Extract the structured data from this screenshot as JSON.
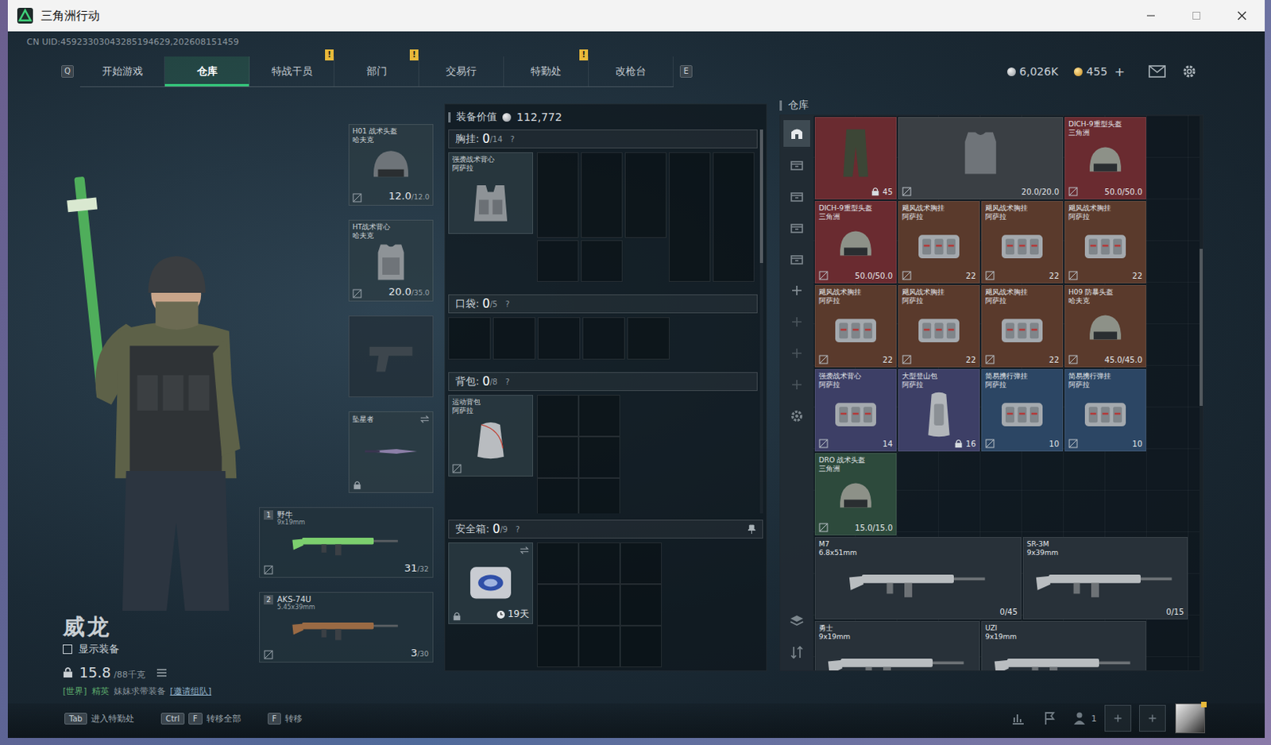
{
  "window": {
    "title": "三角洲行动"
  },
  "uid": "CN UID:45923303043285194629,202608151459",
  "nav": {
    "prev_key": "Q",
    "next_key": "E",
    "tabs": [
      {
        "label": "开始游戏",
        "selected": false,
        "badge": ""
      },
      {
        "label": "仓库",
        "selected": true,
        "badge": ""
      },
      {
        "label": "特战干员",
        "selected": false,
        "badge": "!"
      },
      {
        "label": "部门",
        "selected": false,
        "badge": "!"
      },
      {
        "label": "交易行",
        "selected": false,
        "badge": ""
      },
      {
        "label": "特勤处",
        "selected": false,
        "badge": "!"
      },
      {
        "label": "改枪台",
        "selected": false,
        "badge": ""
      }
    ]
  },
  "wallet": [
    {
      "kind": "silver",
      "amount": "6,026K",
      "add": ""
    },
    {
      "kind": "gold",
      "amount": "455",
      "add": "+"
    }
  ],
  "operator": {
    "name": "威龙",
    "show_gear": {
      "label": "显示装备",
      "checked": false
    },
    "weight": "15.8",
    "weight_limit": "/88千克",
    "chat": {
      "channel": "[世界]",
      "sender": "精英",
      "message": "妹妹求带装备",
      "action": "[邀请组队]"
    }
  },
  "loadout": {
    "helmet": {
      "name": "H01 战术头盔",
      "maker": "哈夫克",
      "durability": "12.0",
      "max": "/12.0"
    },
    "armor": {
      "name": "HT战术背心",
      "maker": "哈夫克",
      "durability": "20.0",
      "max": "/35.0"
    },
    "pistol": {
      "empty": true
    },
    "melee": {
      "name": "坠星者",
      "locked": true
    },
    "weapons": [
      {
        "slot": "1",
        "name": "野牛",
        "caliber": "9x19mm",
        "ammo": "31",
        "mag": "/32",
        "color": "#7ccf6e"
      },
      {
        "slot": "2",
        "name": "AKS-74U",
        "caliber": "5.45x39mm",
        "ammo": "3",
        "mag": "/30",
        "color": "#9a6a44"
      }
    ]
  },
  "equipment_value": {
    "label": "装备价值",
    "amount": "112,772"
  },
  "rig": {
    "label": "胸挂:",
    "used": "0",
    "capacity": "/14",
    "help": "?",
    "item": {
      "name": "强袭战术背心",
      "maker": "阿萨拉"
    }
  },
  "pockets": {
    "label": "口袋:",
    "used": "0",
    "capacity": "/5",
    "help": "?"
  },
  "backpack": {
    "label": "背包:",
    "used": "0",
    "capacity": "/8",
    "help": "?",
    "item": {
      "name": "运动背包",
      "maker": "阿萨拉"
    }
  },
  "safe": {
    "label": "安全箱:",
    "used": "0",
    "capacity": "/9",
    "help": "?",
    "timer": "19天",
    "locked": true
  },
  "warehouse": {
    "title": "仓库",
    "tabs": [
      {
        "kind": "home",
        "selected": true,
        "disabled": false
      },
      {
        "kind": "storage",
        "selected": false,
        "disabled": false
      },
      {
        "kind": "storage",
        "selected": false,
        "disabled": false
      },
      {
        "kind": "storage",
        "selected": false,
        "disabled": false
      },
      {
        "kind": "storage",
        "selected": false,
        "disabled": false
      },
      {
        "kind": "add",
        "selected": false,
        "disabled": false
      },
      {
        "kind": "add",
        "selected": false,
        "disabled": true
      },
      {
        "kind": "add",
        "selected": false,
        "disabled": true
      },
      {
        "kind": "add",
        "selected": false,
        "disabled": true
      },
      {
        "kind": "settings",
        "selected": false,
        "disabled": false
      }
    ],
    "rows": [
      [
        {
          "name": "",
          "maker": "",
          "kind": "pants",
          "color": "#6a2b30",
          "value": "45",
          "lock": true
        },
        {
          "name": "",
          "maker": "",
          "kind": "armor",
          "color": "#3a3f44",
          "value": "20.0/20.0",
          "lock": false
        },
        {
          "name": "DICH-9重型头盔",
          "maker": "三角洲",
          "kind": "helmet",
          "color": "#6a2b30",
          "value": "50.0/50.0",
          "lock": false
        }
      ],
      [
        {
          "name": "DICH-9重型头盔",
          "maker": "三角洲",
          "kind": "helmet",
          "color": "#6a2b30",
          "value": "50.0/50.0",
          "lock": false
        },
        {
          "name": "飓风战术胸挂",
          "maker": "阿萨拉",
          "kind": "rig",
          "color": "#5a3a2c",
          "value": "22",
          "lock": false
        },
        {
          "name": "飓风战术胸挂",
          "maker": "阿萨拉",
          "kind": "rig",
          "color": "#5a3a2c",
          "value": "22",
          "lock": false
        },
        {
          "name": "飓风战术胸挂",
          "maker": "阿萨拉",
          "kind": "rig",
          "color": "#5a3a2c",
          "value": "22",
          "lock": false
        }
      ],
      [
        {
          "name": "飓风战术胸挂",
          "maker": "阿萨拉",
          "kind": "rig",
          "color": "#5a3a2c",
          "value": "22",
          "lock": false
        },
        {
          "name": "飓风战术胸挂",
          "maker": "阿萨拉",
          "kind": "rig",
          "color": "#5a3a2c",
          "value": "22",
          "lock": false
        },
        {
          "name": "飓风战术胸挂",
          "maker": "阿萨拉",
          "kind": "rig",
          "color": "#5a3a2c",
          "value": "22",
          "lock": false
        },
        {
          "name": "H09 防暴头盔",
          "maker": "哈夫克",
          "kind": "helmet",
          "color": "#5a3a2c",
          "value": "45.0/45.0",
          "lock": false
        }
      ],
      [
        {
          "name": "强袭战术背心",
          "maker": "阿萨拉",
          "kind": "rig",
          "color": "#3d3f66",
          "value": "14",
          "lock": false
        },
        {
          "name": "大型登山包",
          "maker": "阿萨拉",
          "kind": "bag",
          "color": "#3d3f66",
          "value": "16",
          "lock": true
        },
        {
          "name": "简易携行弹挂",
          "maker": "阿萨拉",
          "kind": "rig",
          "color": "#2c4664",
          "value": "10",
          "lock": false
        },
        {
          "name": "简易携行弹挂",
          "maker": "阿萨拉",
          "kind": "rig",
          "color": "#2c4664",
          "value": "10",
          "lock": false
        }
      ],
      [
        {
          "name": "DRO 战术头盔",
          "maker": "三角洲",
          "kind": "helmet",
          "color": "#2d4a3c",
          "value": "15.0/15.0",
          "lock": false
        }
      ],
      [
        {
          "name": "M7",
          "maker": "6.8x51mm",
          "kind": "rifle",
          "color": "#283139",
          "value": "0/45",
          "lock": false
        },
        {
          "name": "SR-3M",
          "maker": "9x39mm",
          "kind": "smg",
          "color": "#283139",
          "value": "0/15",
          "lock": false
        }
      ],
      [
        {
          "name": "勇士",
          "maker": "9x19mm",
          "kind": "smg",
          "color": "#283139",
          "value": "",
          "lock": false
        },
        {
          "name": "UZI",
          "maker": "9x19mm",
          "kind": "smg",
          "color": "#283139",
          "value": "",
          "lock": false
        }
      ]
    ]
  },
  "hints": [
    {
      "keys": [
        "Tab"
      ],
      "label": "进入特勤处"
    },
    {
      "keys": [
        "Ctrl",
        "F"
      ],
      "label": "转移全部"
    },
    {
      "keys": [
        "F"
      ],
      "label": "转移"
    }
  ],
  "squad": {
    "count": "1"
  }
}
